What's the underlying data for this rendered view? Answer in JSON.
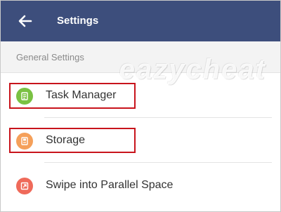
{
  "appbar": {
    "title": "Settings",
    "back_icon": "arrow-left-icon"
  },
  "section": {
    "label": "General Settings"
  },
  "watermark": "eazycheat",
  "items": [
    {
      "label": "Task Manager",
      "icon": "task-manager-icon",
      "color": "#7ac143",
      "highlighted": true
    },
    {
      "label": "Storage",
      "icon": "storage-icon",
      "color": "#f5a05a",
      "highlighted": true
    },
    {
      "label": "Swipe into Parallel Space",
      "icon": "swipe-icon",
      "color": "#ef6a5a",
      "highlighted": false
    }
  ],
  "colors": {
    "appbar": "#3d4e7c",
    "highlight": "#c8141c",
    "section_bg": "#f3f3f3"
  }
}
